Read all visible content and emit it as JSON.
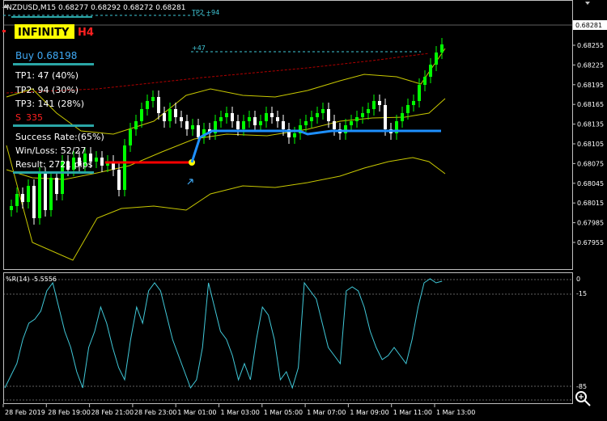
{
  "window": {
    "header": "NZDUSD,M15  0.68277 0.68292 0.68272 0.68281"
  },
  "overlay": {
    "badge_text": "INFINITY",
    "badge_tf": "H4",
    "buy_label": "Buy 0.68198",
    "tp1": "TP1: 47 (40%)",
    "tp2": "TP2: 94 (30%)",
    "tp3": "TP3: 141 (28%)",
    "sl_prefix": "S",
    "sl_value": "335",
    "success": "Success Rate:(65%)",
    "winloss": "Win/Loss: 52/27",
    "result": "Result: 2721 pips"
  },
  "level_labels": {
    "tp2_tp3": "TP2 +94",
    "tp1": "+47"
  },
  "price_axis": {
    "current": "0.68281",
    "ticks": [
      "0.68255",
      "0.68225",
      "0.68195",
      "0.68165",
      "0.68135",
      "0.68105",
      "0.68075",
      "0.68045",
      "0.68015",
      "0.67985",
      "0.67955"
    ]
  },
  "indicator": {
    "label": "%R(14) -5.5556",
    "levels": [
      "0",
      "-15",
      "-85",
      "-100"
    ]
  },
  "time_axis": [
    "28 Feb 2019",
    "28 Feb 19:00",
    "28 Feb 21:00",
    "28 Feb 23:00",
    "1 Mar 01:00",
    "1 Mar 03:00",
    "1 Mar 05:00",
    "1 Mar 07:00",
    "1 Mar 09:00",
    "1 Mar 11:00",
    "1 Mar 13:00"
  ],
  "colors": {
    "bull": "#00ff00",
    "bear": "#ffffff",
    "band": "#c8c800",
    "signal": "#1e90ff",
    "entry": "#ff0000",
    "wpr": "#40c8d8",
    "badge_bg": "#ffff00",
    "badge_tf": "#ff0000",
    "buy": "#3fa9f5"
  },
  "icons": [
    "zoom-icon",
    "arrow-icon",
    "scroll-marker-icon"
  ]
}
